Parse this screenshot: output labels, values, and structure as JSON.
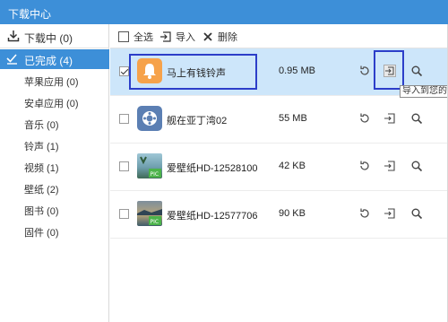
{
  "window": {
    "title": "下载中心"
  },
  "sidebar": {
    "downloading": "下载中 (0)",
    "completed": "已完成 (4)",
    "items": [
      {
        "label": "苹果应用 (0)"
      },
      {
        "label": "安卓应用 (0)"
      },
      {
        "label": "音乐 (0)"
      },
      {
        "label": "铃声 (1)"
      },
      {
        "label": "视频 (1)"
      },
      {
        "label": "壁纸 (2)"
      },
      {
        "label": "图书 (0)"
      },
      {
        "label": "固件 (0)"
      }
    ]
  },
  "toolbar": {
    "select_all": "全选",
    "import": "导入",
    "delete": "删除"
  },
  "files": [
    {
      "name": "马上有钱铃声",
      "size": "0.95 MB",
      "checked": true,
      "thumb": "bell-icon"
    },
    {
      "name": "舰在亚丁湾02",
      "size": "55 MB",
      "checked": false,
      "thumb": "video-app-icon"
    },
    {
      "name": "爱壁纸HD-12528100",
      "size": "42 KB",
      "checked": false,
      "thumb": "wallpaper-pic-icon"
    },
    {
      "name": "爱壁纸HD-12577706",
      "size": "90 KB",
      "checked": false,
      "thumb": "wallpaper-pic-icon"
    }
  ],
  "tooltip": "导入到您的设",
  "colors": {
    "accent": "#3d8fd8",
    "selected_row": "#cde6fa",
    "annotation": "#2c3ec9",
    "bell": "#f6a24a"
  }
}
